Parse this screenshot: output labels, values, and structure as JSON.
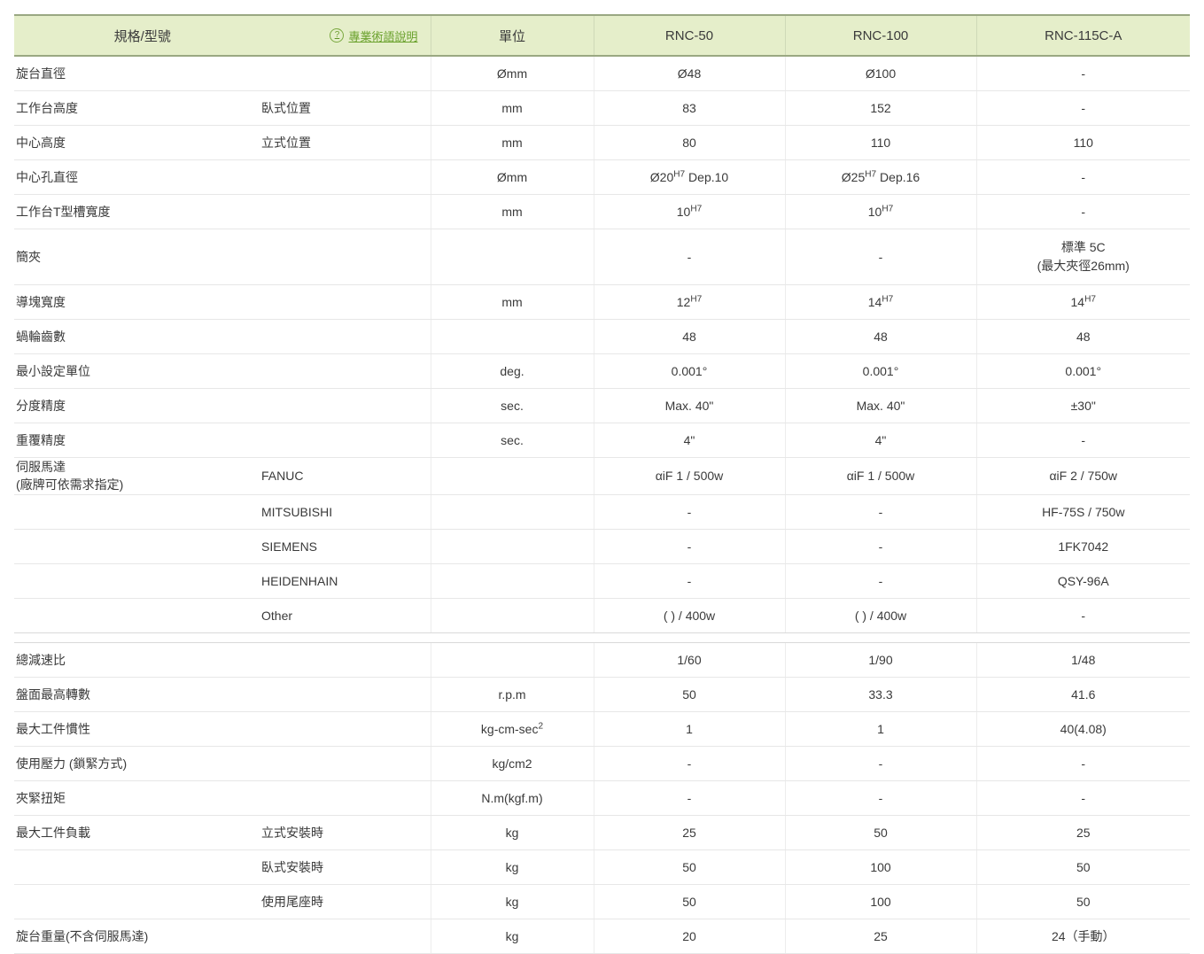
{
  "header": {
    "spec_model": "規格/型號",
    "term_link": "專業術語說明",
    "term_icon": "question-circle-icon",
    "unit": "單位",
    "models": [
      "RNC-50",
      "RNC-100",
      "RNC-115C-A"
    ]
  },
  "colors": {
    "header_bg": "#e5eeca",
    "header_border": "#9aa882",
    "link_green": "#6aa12c",
    "row_border": "#e7e7e7",
    "text": "#3a3a3a"
  },
  "upper_rows": [
    {
      "name": "旋台直徑",
      "note": "",
      "sub": "",
      "unit": "Ømm",
      "values": [
        "Ø48",
        "Ø100",
        "-"
      ]
    },
    {
      "name": "工作台高度",
      "note": "",
      "sub": "臥式位置",
      "unit": "mm",
      "values": [
        "83",
        "152",
        "-"
      ]
    },
    {
      "name": "中心高度",
      "note": "",
      "sub": "立式位置",
      "unit": "mm",
      "values": [
        "80",
        "110",
        "110"
      ]
    },
    {
      "name": "中心孔直徑",
      "note": "",
      "sub": "",
      "unit": "Ømm",
      "values_rich": [
        {
          "base": "Ø20",
          "sup": "H7",
          "tail": " Dep.10"
        },
        {
          "base": "Ø25",
          "sup": "H7",
          "tail": " Dep.16"
        },
        {
          "base": "-",
          "sup": "",
          "tail": ""
        }
      ]
    },
    {
      "name": "工作台T型槽寬度",
      "note": "",
      "sub": "",
      "unit": "mm",
      "values_rich": [
        {
          "base": "10",
          "sup": "H7",
          "tail": ""
        },
        {
          "base": "10",
          "sup": "H7",
          "tail": ""
        },
        {
          "base": "-",
          "sup": "",
          "tail": ""
        }
      ]
    },
    {
      "name": "簡夾",
      "note": "",
      "sub": "",
      "unit": "",
      "tall": true,
      "values": [
        "-",
        "-",
        ""
      ],
      "value3_lines": [
        "標準 5C",
        "(最大夾徑26mm)"
      ]
    },
    {
      "name": "導塊寬度",
      "note": "",
      "sub": "",
      "unit": "mm",
      "values_rich": [
        {
          "base": "12",
          "sup": "H7",
          "tail": ""
        },
        {
          "base": "14",
          "sup": "H7",
          "tail": ""
        },
        {
          "base": "14",
          "sup": "H7",
          "tail": ""
        }
      ]
    },
    {
      "name": "蝸輪齒數",
      "note": "",
      "sub": "",
      "unit": "",
      "values": [
        "48",
        "48",
        "48"
      ]
    },
    {
      "name": "最小設定單位",
      "note": "",
      "sub": "",
      "unit": "deg.",
      "values": [
        "0.001°",
        "0.001°",
        "0.001°"
      ]
    },
    {
      "name": "分度精度",
      "note": "",
      "sub": "",
      "unit": "sec.",
      "values": [
        "Max. 40\"",
        "Max. 40\"",
        "±30\""
      ]
    },
    {
      "name": "重覆精度",
      "note": "",
      "sub": "",
      "unit": "sec.",
      "values": [
        "4\"",
        "4\"",
        "-"
      ]
    },
    {
      "name": "伺服馬達",
      "note": "(廠牌可依需求指定)",
      "sub": "FANUC",
      "unit": "",
      "values": [
        "αiF 1 / 500w",
        "αiF 1 / 500w",
        "αiF 2 / 750w"
      ]
    },
    {
      "name": "",
      "note": "",
      "sub": "MITSUBISHI",
      "unit": "",
      "values": [
        "-",
        "-",
        "HF-75S / 750w"
      ]
    },
    {
      "name": "",
      "note": "",
      "sub": "SIEMENS",
      "unit": "",
      "values": [
        "-",
        "-",
        "1FK7042"
      ]
    },
    {
      "name": "",
      "note": "",
      "sub": "HEIDENHAIN",
      "unit": "",
      "values": [
        "-",
        "-",
        "QSY-96A"
      ]
    },
    {
      "name": "",
      "note": "",
      "sub": "Other",
      "unit": "",
      "values": [
        "( ) / 400w",
        "( ) / 400w",
        "-"
      ]
    }
  ],
  "lower_rows": [
    {
      "name": "總減速比",
      "sub": "",
      "unit": "",
      "values": [
        "1/60",
        "1/90",
        "1/48"
      ]
    },
    {
      "name": "盤面最高轉數",
      "sub": "",
      "unit": "r.p.m",
      "values": [
        "50",
        "33.3",
        "41.6"
      ]
    },
    {
      "name": "最大工件慣性",
      "sub": "",
      "unit_base": "kg-cm-sec",
      "unit_sup": "2",
      "unit": "",
      "values": [
        "1",
        "1",
        "40(4.08)"
      ]
    },
    {
      "name": "使用壓力 (鎖緊方式)",
      "sub": "",
      "unit": "kg/cm2",
      "values": [
        "-",
        "-",
        "-"
      ]
    },
    {
      "name": "夾緊扭矩",
      "sub": "",
      "unit": "N.m(kgf.m)",
      "values": [
        "-",
        "-",
        "-"
      ]
    },
    {
      "name": "最大工件負載",
      "sub": "立式安裝時",
      "unit": "kg",
      "values": [
        "25",
        "50",
        "25"
      ]
    },
    {
      "name": "",
      "sub": "臥式安裝時",
      "unit": "kg",
      "values": [
        "50",
        "100",
        "50"
      ]
    },
    {
      "name": "",
      "sub": "使用尾座時",
      "unit": "kg",
      "values": [
        "50",
        "100",
        "50"
      ]
    },
    {
      "name": "旋台重量(不含伺服馬達)",
      "sub": "",
      "unit": "kg",
      "values": [
        "20",
        "25",
        "24（手動）"
      ]
    }
  ]
}
